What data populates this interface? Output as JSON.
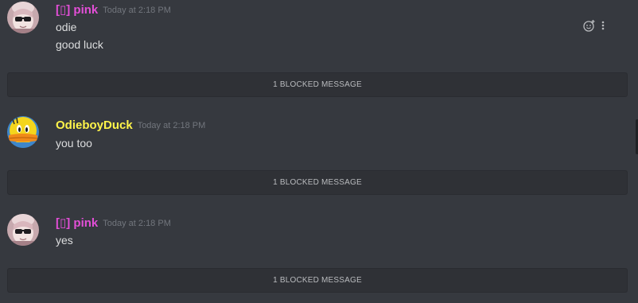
{
  "colors": {
    "background": "#36393f",
    "pink_name": "#e34fd7",
    "duck_name": "#fff44a",
    "timestamp": "#72767d",
    "message_text": "#dcddde",
    "blocked_bar": "#2f3136"
  },
  "messages": [
    {
      "author": "[▯] pink",
      "timestamp": "Today at 2:18 PM",
      "lines": [
        "odie",
        "good luck"
      ],
      "avatar_icon": "pink-anime-avatar"
    },
    {
      "author": "OdieboyDuck",
      "timestamp": "Today at 2:18 PM",
      "lines": [
        "you too"
      ],
      "avatar_icon": "yellow-duck-avatar"
    },
    {
      "author": "[▯] pink",
      "timestamp": "Today at 2:18 PM",
      "lines": [
        "yes"
      ],
      "avatar_icon": "pink-anime-avatar"
    }
  ],
  "blocked": {
    "label_1": "1 BLOCKED MESSAGE",
    "label_2": "1 BLOCKED MESSAGE",
    "label_3": "1 BLOCKED MESSAGE"
  },
  "hover_actions": {
    "reaction_icon": "add-reaction-icon",
    "more_icon": "more-options-icon"
  }
}
